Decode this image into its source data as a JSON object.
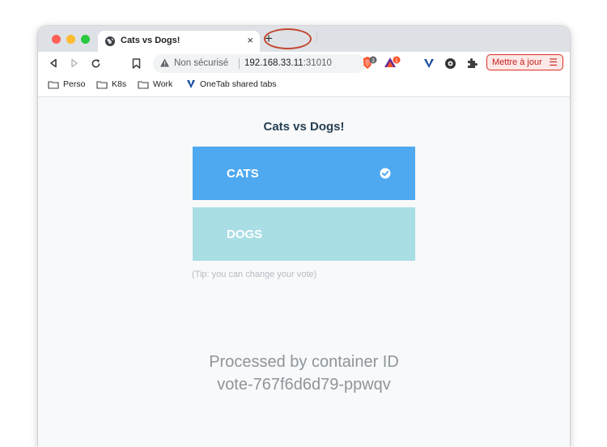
{
  "browser": {
    "tab_title": "Cats vs Dogs!",
    "tab_icon": "globe-icon",
    "new_tab_label": "+",
    "close_label": "×",
    "security_label": "Non sécurisé",
    "url_host": "192.168.33.11",
    "url_port": ":31010",
    "brave_badge": "3",
    "rewards_badge": "1",
    "update_label": "Mettre à jour",
    "update_menu_glyph": "☰",
    "accent_color": "#c5221f"
  },
  "bookmarks": [
    {
      "label": "Perso",
      "icon": "folder-icon"
    },
    {
      "label": "K8s",
      "icon": "folder-icon"
    },
    {
      "label": "Work",
      "icon": "folder-icon"
    },
    {
      "label": "OneTab shared tabs",
      "icon": "onetab-icon"
    }
  ],
  "page": {
    "title": "Cats vs Dogs!",
    "option_a": "CATS",
    "option_b": "DOGS",
    "selected": "CATS",
    "option_a_color": "#4fa9f0",
    "option_b_color": "#a8dee4",
    "tip": "(Tip: you can change your vote)",
    "processed_by": "Processed by container ID",
    "container_id": "vote-767f6d6d79-ppwqv"
  }
}
